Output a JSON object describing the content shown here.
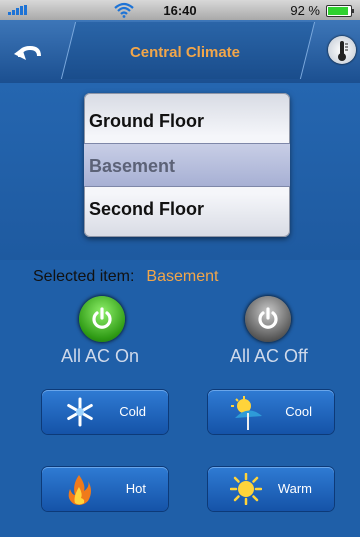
{
  "status": {
    "time": "16:40",
    "battery_pct": "92 %",
    "battery_level": 0.92
  },
  "nav": {
    "title": "Central Climate"
  },
  "picker": {
    "rows": [
      "Ground Floor",
      "Basement",
      "Second Floor"
    ],
    "selected_index": 1
  },
  "selection": {
    "label": "Selected item:",
    "value": "Basement"
  },
  "power": {
    "on_label": "All AC On",
    "off_label": "All AC Off"
  },
  "modes": {
    "cold": "Cold",
    "cool": "Cool",
    "hot": "Hot",
    "warm": "Warm"
  },
  "icons": [
    "signal-icon",
    "wifi-icon",
    "battery-icon",
    "back-icon",
    "thermometer-icon",
    "power-icon",
    "snowflake-icon",
    "sun-umbrella-icon",
    "flame-icon",
    "sun-icon"
  ],
  "colors": {
    "accent": "#f2a64a",
    "background": "#1f5fa8",
    "on_green": "#2e9a14"
  }
}
